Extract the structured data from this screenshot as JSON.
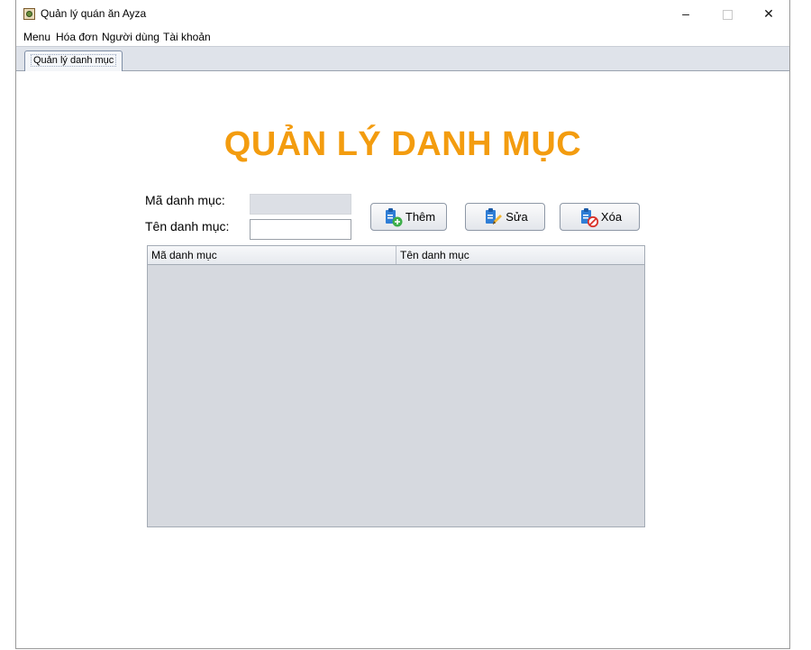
{
  "window": {
    "title": "Quản lý quán ăn Ayza",
    "minimize_glyph": "–",
    "close_glyph": "✕"
  },
  "menubar": {
    "items": [
      "Menu",
      "Hóa đơn",
      "Người dùng",
      "Tài khoản"
    ]
  },
  "tabs": [
    {
      "label": "Quản lý danh mục",
      "selected": true
    }
  ],
  "page": {
    "title": "QUẢN LÝ DANH MỤC",
    "title_color": "#f39c0f"
  },
  "form": {
    "id_label": "Mã danh mục:",
    "id_value": "",
    "name_label": "Tên danh mục:",
    "name_value": ""
  },
  "buttons": {
    "add": {
      "label": "Thêm",
      "icon": "clipboard-add-icon"
    },
    "edit": {
      "label": "Sửa",
      "icon": "clipboard-edit-icon"
    },
    "delete": {
      "label": "Xóa",
      "icon": "clipboard-delete-icon"
    }
  },
  "table": {
    "columns": [
      "Mã danh mục",
      "Tên danh mục"
    ],
    "rows": []
  }
}
